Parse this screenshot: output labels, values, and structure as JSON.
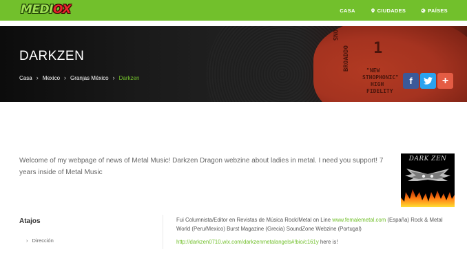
{
  "header": {
    "logo_part1": "MEDI",
    "logo_part2": "OX",
    "nav": [
      {
        "label": "CASA"
      },
      {
        "label": "CIUDADES",
        "icon": "map-marker-icon"
      },
      {
        "label": "PAÍSES",
        "icon": "globe-icon"
      }
    ]
  },
  "hero": {
    "title": "DARKZEN",
    "breadcrumb": [
      "Casa",
      "Mexico",
      "Granjas México",
      "Darkzen"
    ],
    "social": {
      "facebook_glyph": "f",
      "twitter_icon": "twitter-bird-icon",
      "share_glyph": "+"
    },
    "record_label_lines": [
      "\"NEW",
      "STHOPHONIC\"",
      "HIGH",
      "FIDELITY"
    ],
    "record_text_vertical": "BROADDO",
    "record_text_top": "ONS",
    "record_glyph": "1"
  },
  "main": {
    "welcome_text": "Welcome of my webpage of news of Metal Music! Darkzen Dragon webzine about ladies in metal. I need you support! 7 years inside of Metal Music",
    "avatar_text": "DARK ZEN",
    "sidebar": {
      "heading": "Atajos",
      "links": [
        {
          "label": "Dirección"
        }
      ]
    },
    "description": {
      "before_link": "Fui Columnista/Editor en Revistas de Música Rock/Metal on Line ",
      "link": "www.femalemetal.com",
      "after_link": " (España) Rock & Metal World (Peru/Mexico) Burst Magazine (Grecia) SoundZone Webzine (Portugal)"
    },
    "url_line": {
      "link": "http://darkzen0710.wix.com/darkzenmetalangels#!bio/c161y",
      "after": " here is!"
    }
  },
  "colors": {
    "brand_green": "#72c02c",
    "facebook": "#3b5998",
    "twitter": "#2aa3ef",
    "share": "#e45c44"
  }
}
